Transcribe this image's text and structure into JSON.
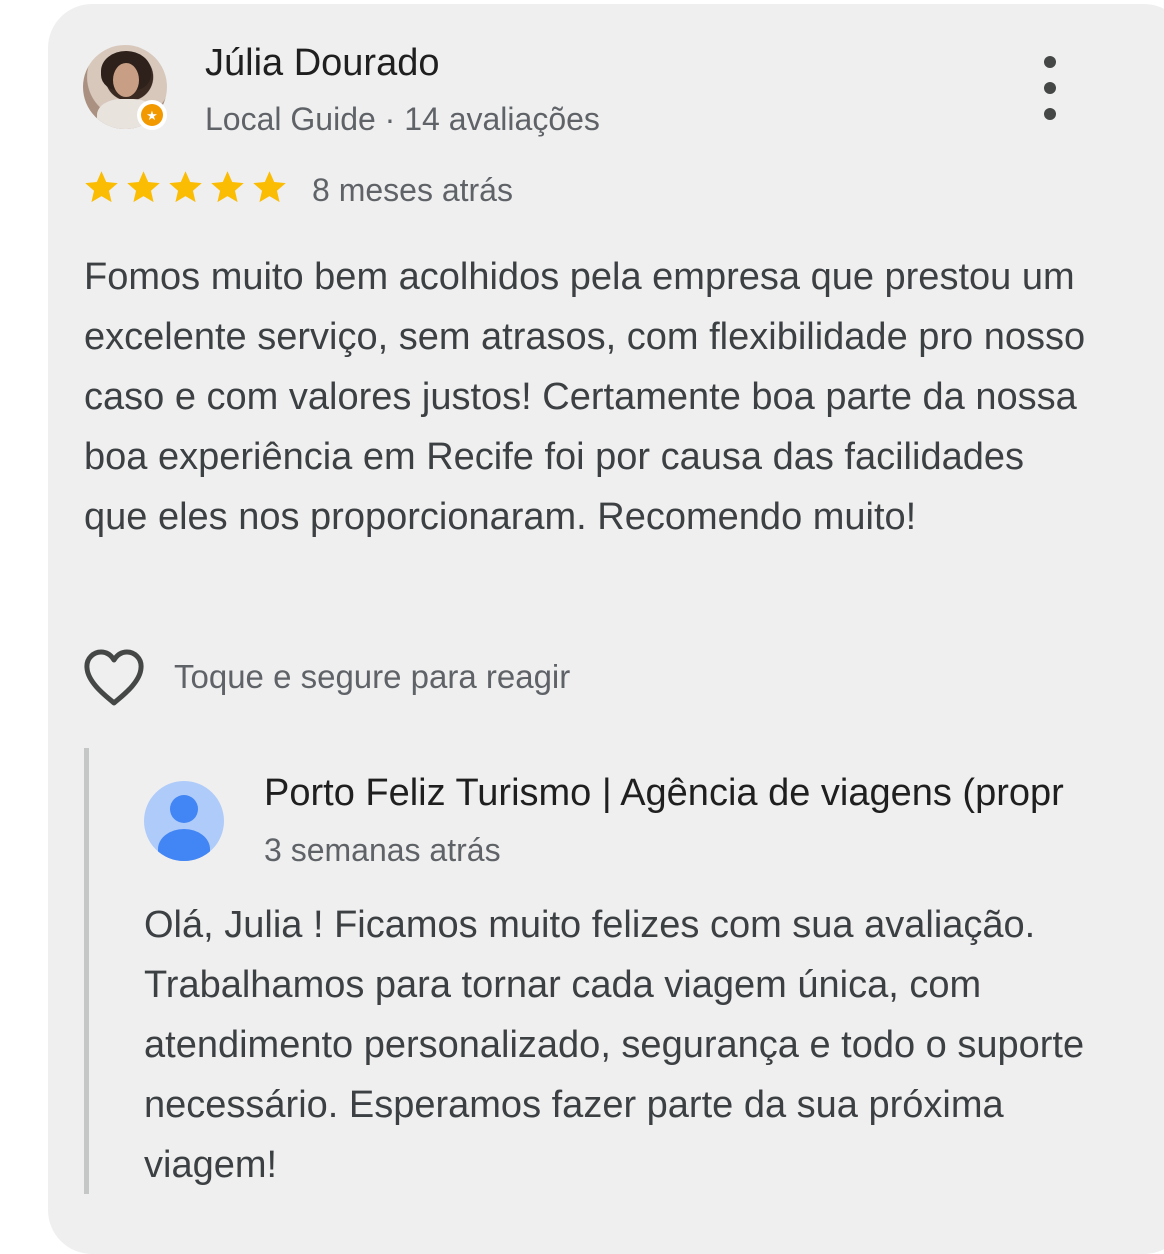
{
  "review": {
    "author_name": "Júlia Dourado",
    "author_meta": "Local Guide · 14 avaliações",
    "rating": 5,
    "rating_max": 5,
    "time_ago": "8 meses atrás",
    "text": "Fomos muito bem acolhidos pela empresa que prestou um excelente serviço, sem atrasos, com flexibilidade pro nosso caso e com valores justos! Certamente boa parte da nossa boa experiência em Recife foi por causa das facilidades que eles nos proporcionaram. Recomendo muito!",
    "react_hint": "Toque e segure para reagir"
  },
  "owner_reply": {
    "name": "Porto Feliz Turismo | Agência de viagens (propr",
    "time_ago": "3 semanas atrás",
    "text": "Olá, Julia ! Ficamos muito felizes com sua avaliação. Trabalhamos para tornar cada viagem única, com atendimento personalizado, segurança e todo o suporte necessário. Esperamos fazer parte da sua próxima viagem!"
  },
  "colors": {
    "card_background": "#efefef",
    "star": "#fbbc04",
    "badge": "#f29900",
    "owner_avatar_bg": "#aecbfa",
    "owner_avatar_fg": "#4285f4"
  },
  "icons": {
    "more": "more-vert-icon",
    "star": "star-icon",
    "heart": "heart-outline-icon",
    "badge": "local-guide-badge-icon"
  }
}
